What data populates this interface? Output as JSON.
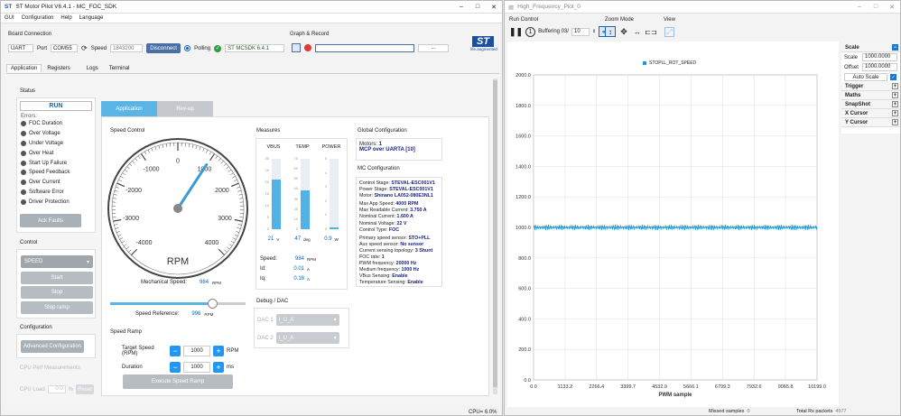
{
  "left": {
    "title": "ST Motor Pilot V6.4.1 - MC_FOC_SDK",
    "menu": [
      "GUI",
      "Configuration",
      "Help",
      "Language"
    ],
    "board_connection": {
      "label": "Board Connection",
      "interface": "UART",
      "port_label": "Port",
      "port": "COM55",
      "speed_label": "Speed",
      "speed": "1843200",
      "disconnect": "Disconnect",
      "polling": "Polling",
      "sdk": "ST MCSDK 6.4.1"
    },
    "graph_record": {
      "label": "Graph & Record",
      "dots": "..."
    },
    "logo_tag": "life.augmented",
    "tabs": [
      "Application",
      "Registers",
      "Logs",
      "Terminal"
    ],
    "status": {
      "label": "Status",
      "state": "RUN",
      "errors_label": "Errors:",
      "errors": [
        "FOC Duration",
        "Over Voltage",
        "Under Voltage",
        "Over Heat",
        "Start Up Failure",
        "Speed Feedback",
        "Over Current",
        "Software Error",
        "Driver Protection"
      ],
      "ack": "Ack Faults"
    },
    "control": {
      "label": "Control",
      "mode": "SPEED",
      "start": "Start",
      "stop": "Stop",
      "stop_ramp": "Stop ramp"
    },
    "configuration": {
      "label": "Configuration",
      "advanced": "Advanced Configuration"
    },
    "cpu_perf": {
      "label": "CPU Perf Measurements",
      "cpu_load_label": "CPU Load",
      "cpu_load": "0.0",
      "pct": "%",
      "reset": "Reset"
    },
    "subtabs": [
      "Application",
      "Rev-up"
    ],
    "speed_control": {
      "label": "Speed Control",
      "gauge_labels": [
        "-4000",
        "-3000",
        "-2000",
        "-1000",
        "0",
        "1000",
        "2000",
        "3000",
        "4000"
      ],
      "unit": "RPM",
      "gauge_value": 984,
      "mech_label": "Mechanical Speed:",
      "mech_value": "984",
      "mech_unit": "RPM",
      "ref_label": "Speed Reference:",
      "ref_value": "996",
      "ref_unit": "RPM",
      "ref_fraction": 0.75
    },
    "speed_ramp": {
      "label": "Speed Ramp",
      "target_label": "Target Speed (RPM)",
      "target_value": "1000",
      "target_unit": "RPM",
      "duration_label": "Duration",
      "duration_value": "1000",
      "duration_unit": "ms",
      "execute": "Execute Speed Ramp"
    },
    "measures": {
      "label": "Measures",
      "vbus": {
        "label": "VBUS",
        "ticks": [
          "30",
          "25",
          "20",
          "15",
          "10",
          "5",
          "0"
        ],
        "value": "21",
        "unit": "V",
        "fraction": 0.7
      },
      "temp": {
        "label": "TEMP",
        "ticks": [
          "70",
          "60",
          "50",
          "40",
          "30",
          "20",
          "10",
          "0"
        ],
        "value": "47",
        "unit": "deg",
        "fraction": 0.55
      },
      "power": {
        "label": "POWER",
        "ticks": [
          "5",
          "4",
          "3",
          "2",
          "1",
          "0"
        ],
        "value": "0.9",
        "unit": "W",
        "fraction": 0.03
      },
      "speed_label": "Speed:",
      "speed_value": "984",
      "speed_unit": "RPM",
      "id_label": "Id:",
      "id_value": "0.01",
      "id_unit": "A",
      "iq_label": "Iq:",
      "iq_value": "0.18",
      "iq_unit": "A"
    },
    "debug": {
      "label": "Debug / DAC",
      "dac1": "DAC 1",
      "dac1_val": "I_U_A",
      "dac2": "DAC 2",
      "dac2_val": "I_U_A"
    },
    "global_config": {
      "label": "Global Configuration",
      "motors_label": "Motors:",
      "motors": "1",
      "mcp": "MCP over UARTA [10]"
    },
    "mc_config": {
      "label": "MC Configuration",
      "items": [
        {
          "k": "Control Stage:",
          "v": "STEVAL-ESC001V1"
        },
        {
          "k": "Power Stage:",
          "v": "STEVAL-ESC001V1"
        },
        {
          "k": "Motor:",
          "v": "Shinano LA052-080E3NL1"
        },
        {
          "k": "Max App Speed:",
          "v": "4000 RPM"
        },
        {
          "k": "Max Readable Current:",
          "v": "3.750 A"
        },
        {
          "k": "Nominal Current:",
          "v": "1.600 A"
        },
        {
          "k": "Nominal Voltage:",
          "v": "22 V"
        },
        {
          "k": "Control Type:",
          "v": "FOC"
        },
        {
          "k": "Primary speed sensor:",
          "v": "STO+PLL"
        },
        {
          "k": "Aux speed sensor:",
          "v": "No sensor"
        },
        {
          "k": "Current sensing topology:",
          "v": "3 Shunt"
        },
        {
          "k": "FOC rate:",
          "v": "1"
        },
        {
          "k": "PWM frequency:",
          "v": "20000 Hz"
        },
        {
          "k": "Medium frequency:",
          "v": "1000 Hz"
        },
        {
          "k": "VBus Sensing:",
          "v": "Enable"
        },
        {
          "k": "Temperature Sensing:",
          "v": "Enable"
        }
      ]
    },
    "cpu_status": "CPU= 6.0%"
  },
  "right": {
    "title": "High_Frequency_Plot_0",
    "run_control": "Run Control",
    "buffering_label": "Buffering 03/",
    "buffering_value": "10",
    "zoom_mode": "Zoom Mode",
    "view": "View",
    "legend": "STOPLL_ROT_SPEED",
    "side": {
      "scale": "Scale",
      "scale_label": "Scale",
      "scale_value": "1000.0000",
      "offset_label": "Offset",
      "offset_value": "1000.0000",
      "auto": "Auto Scale",
      "sections": [
        "Trigger",
        "Maths",
        "SnapShot",
        "X Cursor",
        "Y Cursor"
      ]
    },
    "missed_label": "Missed samples",
    "missed": "0",
    "total_label": "Total Rx packets",
    "total": "4977",
    "line_color": "#1e9bd7"
  },
  "chart_data": {
    "type": "line",
    "title": "",
    "xlabel": "PWM sample",
    "ylabel": "",
    "xlim": [
      0,
      10199
    ],
    "ylim": [
      0,
      2000
    ],
    "x_ticks": [
      "0.0",
      "1133.2",
      "2266.4",
      "3399.7",
      "4532.9",
      "5666.1",
      "6799.3",
      "7932.6",
      "9065.8",
      "10199.0"
    ],
    "y_ticks": [
      "0.0",
      "200.0",
      "400.0",
      "600.0",
      "800.0",
      "1000.0",
      "1200.0",
      "1400.0",
      "1600.0",
      "1800.0",
      "2000.0"
    ],
    "series": [
      {
        "name": "STOPLL_ROT_SPEED",
        "mean": 1000,
        "amplitude": 18
      }
    ]
  }
}
